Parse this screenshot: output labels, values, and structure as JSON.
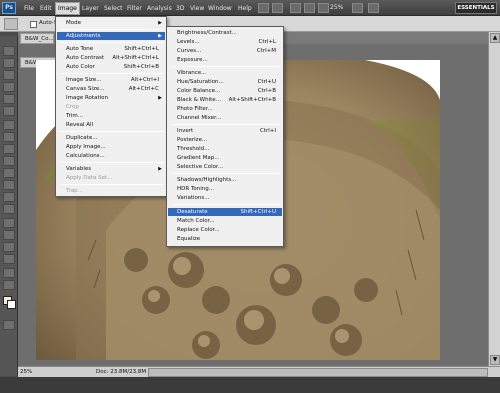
{
  "menubar": {
    "logo": "Ps",
    "items": [
      "File",
      "Edit",
      "Image",
      "Layer",
      "Select",
      "Filter",
      "Analysis",
      "3D",
      "View",
      "Window",
      "Help"
    ],
    "zoom": "25%",
    "workspace": "ESSENTIALS"
  },
  "options": {
    "auto_select": "Auto-Sel"
  },
  "tabs": [
    "B&W_Co...",
    "B&W_Conve..."
  ],
  "image_menu": {
    "items": [
      {
        "label": "Mode",
        "shortcut": "",
        "submenu": true,
        "disabled": false
      },
      {
        "label": "Adjustments",
        "shortcut": "",
        "submenu": true,
        "disabled": false,
        "highlighted": true
      },
      {
        "label": "Auto Tone",
        "shortcut": "Shift+Ctrl+L",
        "submenu": false,
        "disabled": false
      },
      {
        "label": "Auto Contrast",
        "shortcut": "Alt+Shift+Ctrl+L",
        "submenu": false,
        "disabled": false
      },
      {
        "label": "Auto Color",
        "shortcut": "Shift+Ctrl+B",
        "submenu": false,
        "disabled": false
      },
      {
        "label": "Image Size...",
        "shortcut": "Alt+Ctrl+I",
        "submenu": false,
        "disabled": false
      },
      {
        "label": "Canvas Size...",
        "shortcut": "Alt+Ctrl+C",
        "submenu": false,
        "disabled": false
      },
      {
        "label": "Image Rotation",
        "shortcut": "",
        "submenu": true,
        "disabled": false
      },
      {
        "label": "Crop",
        "shortcut": "",
        "submenu": false,
        "disabled": true
      },
      {
        "label": "Trim...",
        "shortcut": "",
        "submenu": false,
        "disabled": false
      },
      {
        "label": "Reveal All",
        "shortcut": "",
        "submenu": false,
        "disabled": false
      },
      {
        "label": "Duplicate...",
        "shortcut": "",
        "submenu": false,
        "disabled": false
      },
      {
        "label": "Apply Image...",
        "shortcut": "",
        "submenu": false,
        "disabled": false
      },
      {
        "label": "Calculations...",
        "shortcut": "",
        "submenu": false,
        "disabled": false
      },
      {
        "label": "Variables",
        "shortcut": "",
        "submenu": true,
        "disabled": false
      },
      {
        "label": "Apply Data Set...",
        "shortcut": "",
        "submenu": false,
        "disabled": true
      },
      {
        "label": "Trap...",
        "shortcut": "",
        "submenu": false,
        "disabled": true
      }
    ]
  },
  "adjustments_menu": {
    "items": [
      {
        "label": "Brightness/Contrast...",
        "shortcut": ""
      },
      {
        "label": "Levels...",
        "shortcut": "Ctrl+L"
      },
      {
        "label": "Curves...",
        "shortcut": "Ctrl+M"
      },
      {
        "label": "Exposure...",
        "shortcut": ""
      },
      {
        "label": "Vibrance...",
        "shortcut": ""
      },
      {
        "label": "Hue/Saturation...",
        "shortcut": "Ctrl+U"
      },
      {
        "label": "Color Balance...",
        "shortcut": "Ctrl+B"
      },
      {
        "label": "Black & White...",
        "shortcut": "Alt+Shift+Ctrl+B"
      },
      {
        "label": "Photo Filter...",
        "shortcut": ""
      },
      {
        "label": "Channel Mixer...",
        "shortcut": ""
      },
      {
        "label": "Invert",
        "shortcut": "Ctrl+I"
      },
      {
        "label": "Posterize...",
        "shortcut": ""
      },
      {
        "label": "Threshold...",
        "shortcut": ""
      },
      {
        "label": "Gradient Map...",
        "shortcut": ""
      },
      {
        "label": "Selective Color...",
        "shortcut": ""
      },
      {
        "label": "Shadows/Highlights...",
        "shortcut": ""
      },
      {
        "label": "HDR Toning...",
        "shortcut": ""
      },
      {
        "label": "Variations...",
        "shortcut": ""
      },
      {
        "label": "Desaturate",
        "shortcut": "Shift+Ctrl+U",
        "highlighted": true
      },
      {
        "label": "Match Color...",
        "shortcut": ""
      },
      {
        "label": "Replace Color...",
        "shortcut": ""
      },
      {
        "label": "Equalize",
        "shortcut": ""
      }
    ]
  },
  "status": {
    "zoom": "25%",
    "doc": "Doc: 23.8M/23.8M"
  },
  "colors": {
    "highlight": "#3468b8",
    "stone": "#a08a66",
    "moss": "#8a8a3a"
  }
}
